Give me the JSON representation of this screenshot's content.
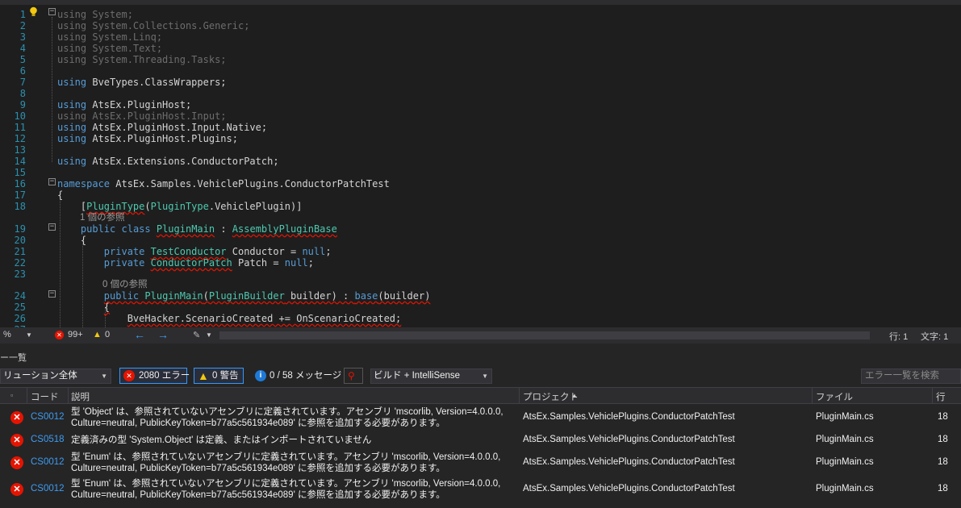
{
  "editor": {
    "lines": [
      {
        "n": "1",
        "html": "<span class=\"dim\">using System;</span>"
      },
      {
        "n": "2",
        "html": "<span class=\"dim\">using System.Collections.Generic;</span>"
      },
      {
        "n": "3",
        "html": "<span class=\"dim\">using System.Linq;</span>"
      },
      {
        "n": "4",
        "html": "<span class=\"dim\">using System.Text;</span>"
      },
      {
        "n": "5",
        "html": "<span class=\"dim\">using System.Threading.Tasks;</span>"
      },
      {
        "n": "6",
        "html": ""
      },
      {
        "n": "7",
        "html": "<span class=\"kw\">using</span> BveTypes.ClassWrappers;"
      },
      {
        "n": "8",
        "html": ""
      },
      {
        "n": "9",
        "html": "<span class=\"kw\">using</span> AtsEx.PluginHost;"
      },
      {
        "n": "10",
        "html": "<span class=\"dim\">using AtsEx.PluginHost.Input;</span>"
      },
      {
        "n": "11",
        "html": "<span class=\"kw\">using</span> AtsEx.PluginHost.Input.Native;"
      },
      {
        "n": "12",
        "html": "<span class=\"kw\">using</span> AtsEx.PluginHost.Plugins;"
      },
      {
        "n": "13",
        "html": ""
      },
      {
        "n": "14",
        "html": "<span class=\"kw\">using</span> AtsEx.Extensions.ConductorPatch;"
      },
      {
        "n": "15",
        "html": ""
      },
      {
        "n": "16",
        "html": "<span class=\"kw\">namespace</span> AtsEx.Samples.VehiclePlugins.ConductorPatchTest"
      },
      {
        "n": "17",
        "html": "{"
      },
      {
        "n": "18",
        "html": "    [<span class=\"ty squig\">PluginType</span>(<span class=\"ty\">PluginType</span>.VehiclePlugin)]"
      },
      {
        "n": "19",
        "html": "    <span class=\"kw\">public</span> <span class=\"kw\">class</span> <span class=\"ty squig\">PluginMain</span> : <span class=\"ty squig\">AssemblyPluginBase</span>"
      },
      {
        "n": "20",
        "html": "    {"
      },
      {
        "n": "21",
        "html": "        <span class=\"kw\">private</span> <span class=\"ty squig\">TestConductor</span> Conductor = <span class=\"kw\">null</span>;"
      },
      {
        "n": "22",
        "html": "        <span class=\"kw\">private</span> <span class=\"ty squig\">ConductorPatch</span> Patch = <span class=\"kw\">null</span>;"
      },
      {
        "n": "23",
        "html": ""
      },
      {
        "n": "24",
        "html": "        <span class=\"kw squig\">public</span><span class=\"squig\"> </span><span class=\"ty squig\">PluginMain</span><span class=\"squig\">(</span><span class=\"ty squig\">PluginBuilder</span><span class=\"squig\"> builder) : </span><span class=\"kw squig\">base</span><span class=\"squig\">(builder)</span>"
      },
      {
        "n": "25",
        "html": "        <span class=\"squig\">{</span>"
      },
      {
        "n": "26",
        "html": "            <span class=\"squig\">BveHacker.ScenarioCreated += OnScenarioCreated;</span>"
      },
      {
        "n": "27",
        "html": ""
      }
    ],
    "codelens": [
      "1 個の参照",
      "1 個の参照",
      "0 個の参照"
    ]
  },
  "statusbar": {
    "zoom": "%",
    "errors": "99+",
    "warnings": "0",
    "line": "行: 1",
    "col": "文字: 1"
  },
  "panel": {
    "title": "ー一覧",
    "scope": "リューション全体",
    "errors_btn": "2080 エラー",
    "warnings_btn": "0 警告",
    "messages_btn": "0 / 58 メッセージ",
    "build_filter": "ビルド + IntelliSense",
    "search_placeholder": "エラー一覧を検索",
    "columns": {
      "code": "コード",
      "desc": "説明",
      "project": "プロジェクト",
      "file": "ファイル",
      "line": "行"
    },
    "rows": [
      {
        "code": "CS0012",
        "desc1": "型 'Object' は、参照されていないアセンブリに定義されています。アセンブリ 'mscorlib, Version=4.0.0.0,",
        "desc2": "Culture=neutral, PublicKeyToken=b77a5c561934e089' に参照を追加する必要があります。",
        "project": "AtsEx.Samples.VehiclePlugins.ConductorPatchTest",
        "file": "PluginMain.cs",
        "line": "18"
      },
      {
        "code": "CS0518",
        "desc1": "定義済みの型 'System.Object' は定義、またはインポートされていません",
        "desc2": "",
        "project": "AtsEx.Samples.VehiclePlugins.ConductorPatchTest",
        "file": "PluginMain.cs",
        "line": "18"
      },
      {
        "code": "CS0012",
        "desc1": "型 'Enum' は、参照されていないアセンブリに定義されています。アセンブリ 'mscorlib, Version=4.0.0.0,",
        "desc2": "Culture=neutral, PublicKeyToken=b77a5c561934e089' に参照を追加する必要があります。",
        "project": "AtsEx.Samples.VehiclePlugins.ConductorPatchTest",
        "file": "PluginMain.cs",
        "line": "18"
      },
      {
        "code": "CS0012",
        "desc1": "型 'Enum' は、参照されていないアセンブリに定義されています。アセンブリ 'mscorlib, Version=4.0.0.0,",
        "desc2": "Culture=neutral, PublicKeyToken=b77a5c561934e089' に参照を追加する必要があります。",
        "project": "AtsEx.Samples.VehiclePlugins.ConductorPatchTest",
        "file": "PluginMain.cs",
        "line": "18"
      }
    ]
  },
  "colors": {
    "accent": "#3399ff",
    "error": "#e51400",
    "keyword": "#569cd6",
    "type": "#4ec9b0",
    "lineNumber": "#2b91af"
  }
}
